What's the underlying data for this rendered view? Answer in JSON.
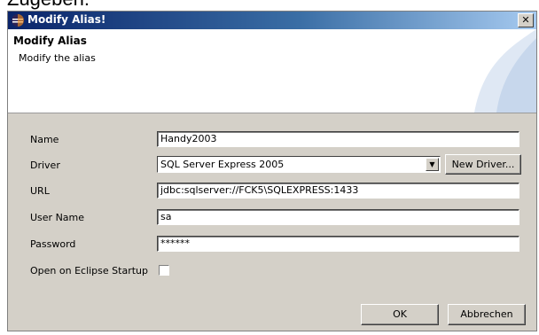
{
  "page": {
    "top_text": "Zugeben:"
  },
  "window": {
    "title": "Modify Alias!",
    "close_glyph": "✕"
  },
  "header": {
    "title": "Modify Alias",
    "description": "Modify the alias"
  },
  "form": {
    "name": {
      "label": "Name",
      "value": "Handy2003"
    },
    "driver": {
      "label": "Driver",
      "value": "SQL Server Express 2005",
      "new_driver_label": "New Driver..."
    },
    "url": {
      "label": "URL",
      "value": "jdbc:sqlserver://FCK5\\SQLEXPRESS:1433"
    },
    "user_name": {
      "label": "User Name",
      "value": "sa"
    },
    "password": {
      "label": "Password",
      "value": "******"
    },
    "open_on_startup": {
      "label": "Open on Eclipse Startup",
      "checked": false
    }
  },
  "buttons": {
    "ok_label": "OK",
    "cancel_label": "Abbrechen"
  },
  "colors": {
    "titlebar_start": "#0a246a",
    "titlebar_end": "#a6caf0",
    "dialog_bg": "#d4d0c8"
  },
  "icons": {
    "app": "eclipse-icon",
    "close": "close-icon",
    "dropdown": "dropdown-arrow-icon"
  }
}
